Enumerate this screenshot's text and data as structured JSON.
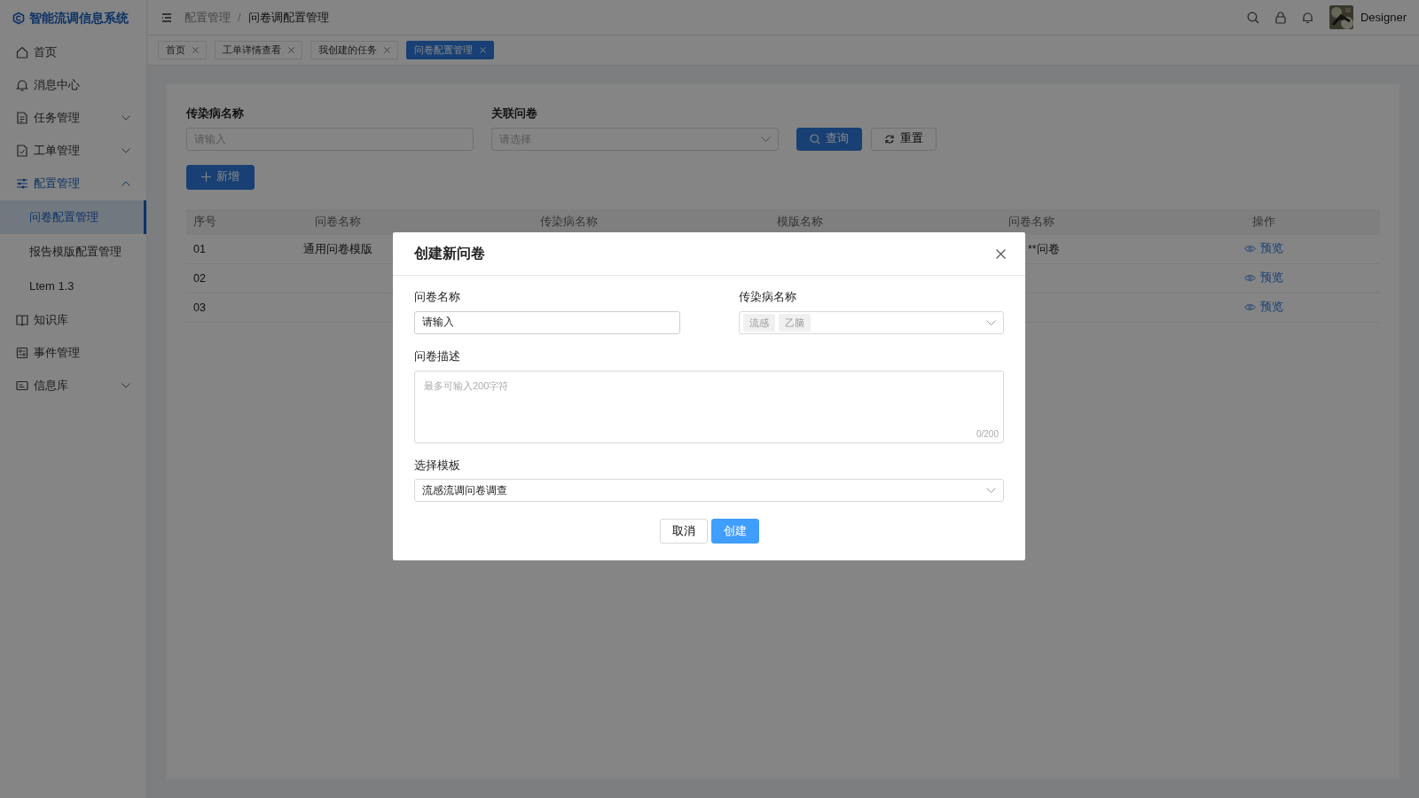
{
  "app": {
    "title": "智能流调信息系统"
  },
  "sidebar": {
    "items": [
      {
        "label": "首页",
        "selected": false
      },
      {
        "label": "消息中心",
        "selected": false
      },
      {
        "label": "任务管理",
        "selected": false,
        "expanded": false
      },
      {
        "label": "工单管理",
        "selected": false,
        "expanded": false
      },
      {
        "label": "配置管理",
        "selected": true,
        "expanded": true,
        "children": [
          {
            "label": "问卷配置管理",
            "selected": true
          },
          {
            "label": "报告模版配置管理",
            "selected": false
          },
          {
            "label": "Ltem 1.3",
            "selected": false
          }
        ]
      },
      {
        "label": "知识库",
        "selected": false
      },
      {
        "label": "事件管理",
        "selected": false
      },
      {
        "label": "信息库",
        "selected": false,
        "expanded": false
      }
    ]
  },
  "header": {
    "breadcrumb": [
      "配置管理",
      "问卷调配置管理"
    ],
    "breadcrumb_separator": "/",
    "user": "Designer"
  },
  "tabs": [
    {
      "label": "首页",
      "selected": false
    },
    {
      "label": "工单详情查看",
      "selected": false
    },
    {
      "label": "我创建的任务",
      "selected": false
    },
    {
      "label": "问卷配置管理",
      "selected": true
    }
  ],
  "filters": [
    {
      "kind": "input",
      "label": "传染病名称",
      "placeholder": "请输入"
    },
    {
      "kind": "select",
      "label": "关联问卷",
      "placeholder": "请选择"
    }
  ],
  "filter_buttons": {
    "query": "查询",
    "reset": "重置"
  },
  "add_button": "新增",
  "table": {
    "columns": [
      "序号",
      "问卷名称",
      "传染病名称",
      "模版名称",
      "问卷名称",
      "操作"
    ],
    "rows": [
      {
        "number": "01",
        "name": "通用问卷模版",
        "column_5": "**问卷",
        "action": "预览"
      },
      {
        "number": "02",
        "action": "预览"
      },
      {
        "number": "03",
        "action": "预览"
      }
    ]
  },
  "modal": {
    "title": "创建新问卷",
    "name_field": {
      "label": "问卷名称",
      "value": "请输入"
    },
    "disease_field": {
      "label": "传染病名称",
      "tags": [
        "流感",
        "乙脑"
      ]
    },
    "description_field": {
      "label": "问卷描述",
      "placeholder": "最多可输入200字符",
      "counter": "0/200"
    },
    "template_field": {
      "label": "选择模板",
      "value": "流感流调问卷调查"
    },
    "buttons": {
      "cancel": "取消",
      "create": "创建"
    }
  }
}
